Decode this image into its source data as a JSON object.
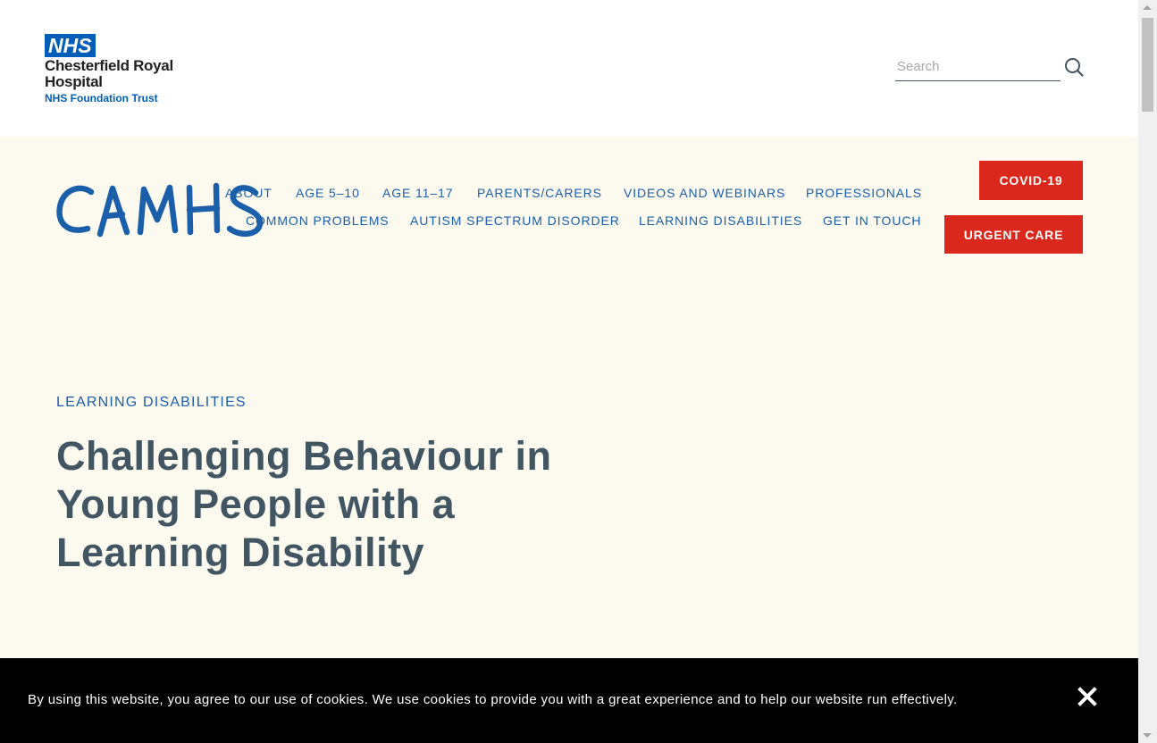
{
  "header": {
    "logo": {
      "badge": "NHS",
      "line1": "Chesterfield Royal",
      "line2": "Hospital",
      "sub": "NHS Foundation Trust"
    },
    "search": {
      "placeholder": "Search",
      "value": ""
    }
  },
  "site": {
    "logo_text": "CAMHS"
  },
  "nav": {
    "row1": [
      "ABOUT",
      "AGE 5–10",
      "AGE 11–17",
      "PARENTS/CARERS",
      "VIDEOS AND WEBINARS",
      "PROFESSIONALS"
    ],
    "row2": [
      "COMMON PROBLEMS",
      "AUTISM SPECTRUM DISORDER",
      "LEARNING DISABILITIES",
      "GET IN TOUCH"
    ]
  },
  "buttons": {
    "covid": "COVID-19",
    "urgent": "URGENT CARE"
  },
  "hero": {
    "section": "LEARNING DISABILITIES",
    "title": "Challenging Behaviour in Young People with a Learning Disability"
  },
  "cookie": {
    "text": "By using this website, you agree to our use of cookies. We use cookies to provide you with a great experience and to help our website run effectively."
  },
  "colors": {
    "nhs_blue": "#005eb8",
    "nav_blue": "#1b5faa",
    "title_slate": "#425563",
    "hero_bg": "#fcf9ee",
    "button_red": "#da291c"
  }
}
